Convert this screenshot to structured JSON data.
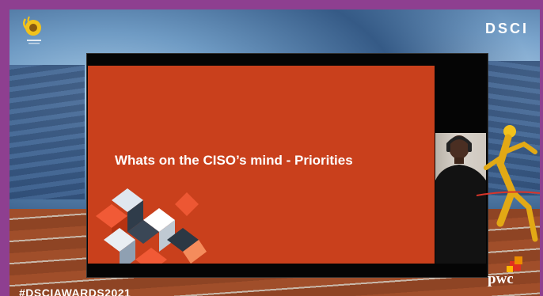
{
  "event": {
    "hashtag": "#DSCIAWARDS2021",
    "sponsor_logo": "DSCI",
    "partner_logo": "pwc"
  },
  "presentation": {
    "slide_title": "Whats on the CISO’s mind - Priorities"
  },
  "colors": {
    "frame_border": "#8e3f90",
    "slide_background": "#c9401c",
    "player_background": "#050505"
  },
  "icons": {
    "left_logo": "trophy-icon",
    "decoration": "geometric-cubes-icon"
  }
}
